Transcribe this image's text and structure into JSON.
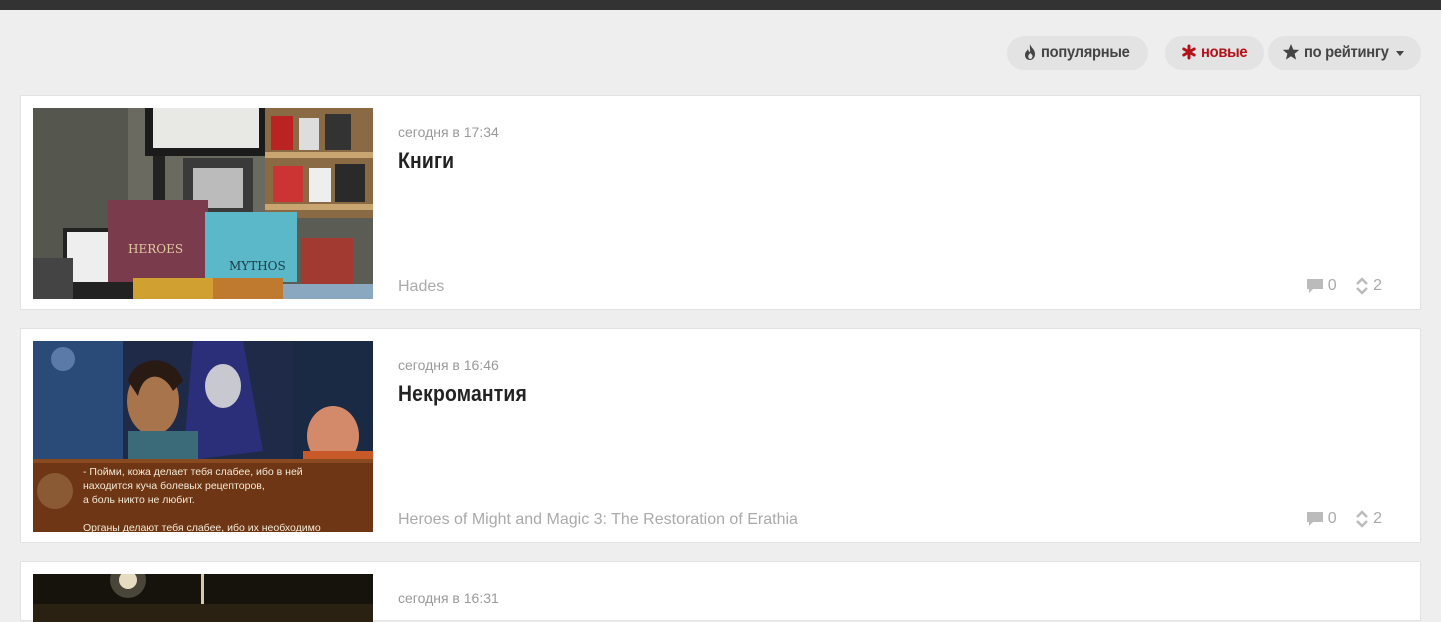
{
  "sort": {
    "popular_label": "популярные",
    "new_label": "новые",
    "rating_label": "по рейтингу",
    "active": "new",
    "accent_color": "#b3121b"
  },
  "posts": [
    {
      "date": "сегодня в 17:34",
      "title": "Книги",
      "tag": "Hades",
      "comments": "0",
      "rating": "2",
      "thumb": {
        "kind": "bookstore-photo",
        "book_labels": [
          "HEROES",
          "MYTHOS"
        ]
      }
    },
    {
      "date": "сегодня в 16:46",
      "title": "Некромантия",
      "tag": "Heroes of Might and Magic 3: The Restoration of Erathia",
      "comments": "0",
      "rating": "2",
      "thumb": {
        "kind": "game-screenshot",
        "caption_lines": [
          "- Пойми, кожа делает тебя слабее, ибо в ней",
          "находится куча болевых рецепторов,",
          "а боль никто не любит.",
          "Органы делают тебя слабее, ибо их необходимо"
        ]
      }
    },
    {
      "date": "сегодня в 16:31",
      "thumb": {
        "kind": "dark-photo"
      }
    }
  ],
  "icons": {
    "popular": "flame-icon",
    "new": "asterisk-icon",
    "rating": "star-icon",
    "comments": "comment-icon",
    "votes": "updown-arrows-icon"
  }
}
